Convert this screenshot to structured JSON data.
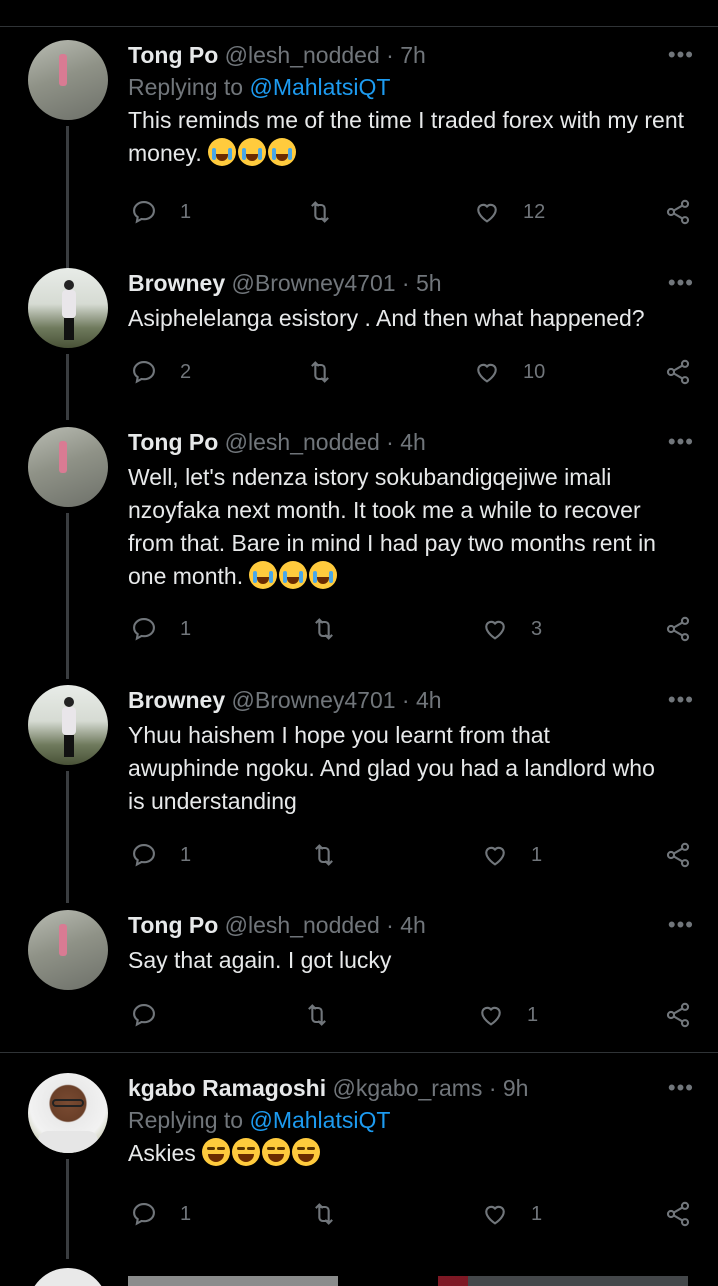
{
  "tweets": [
    {
      "name": "Tong Po",
      "handle": "@lesh_nodded",
      "time": "7h",
      "replying_label": "Replying to",
      "replying_to": "@MahlatsiQT",
      "text": "This reminds me of the time I traded forex with my rent money.",
      "emoji": "crying-face x3",
      "replies": "1",
      "likes": "12"
    },
    {
      "name": "Browney",
      "handle": "@Browney4701",
      "time": "5h",
      "text": "Asiphelelanga esistory . And then what happened?",
      "replies": "2",
      "likes": "10"
    },
    {
      "name": "Tong Po",
      "handle": "@lesh_nodded",
      "time": "4h",
      "text_lines": [
        "Well, let's ndenza istory sokubandigqejiwe imali",
        "nzoyfaka next month. It took me a while to recover",
        "from that. Bare in mind I had pay two months rent in",
        "one month."
      ],
      "emoji": "crying-face x3",
      "replies": "1",
      "likes": "3"
    },
    {
      "name": "Browney",
      "handle": "@Browney4701",
      "time": "4h",
      "text_lines": [
        "Yhuu haishem I hope you learnt from that",
        "awuphinde ngoku. And glad you had a landlord who",
        "is understanding"
      ],
      "replies": "1",
      "likes": "1"
    },
    {
      "name": "Tong Po",
      "handle": "@lesh_nodded",
      "time": "4h",
      "text": "Say that again. I got lucky",
      "replies": "",
      "likes": "1"
    },
    {
      "name": "kgabo Ramagoshi",
      "handle": "@kgabo_rams",
      "time": "9h",
      "replying_label": "Replying to",
      "replying_to": "@MahlatsiQT",
      "text": "Askies",
      "emoji": "laughing-face x4",
      "replies": "1",
      "likes": "1"
    }
  ],
  "separator": "·",
  "more_glyph": "•••",
  "icons": [
    "reply-icon",
    "retweet-icon",
    "like-icon",
    "share-icon",
    "more-icon"
  ],
  "colors": {
    "background": "#000000",
    "text": "#e7e9ea",
    "secondary": "#71767b",
    "link": "#1d9bf0"
  }
}
